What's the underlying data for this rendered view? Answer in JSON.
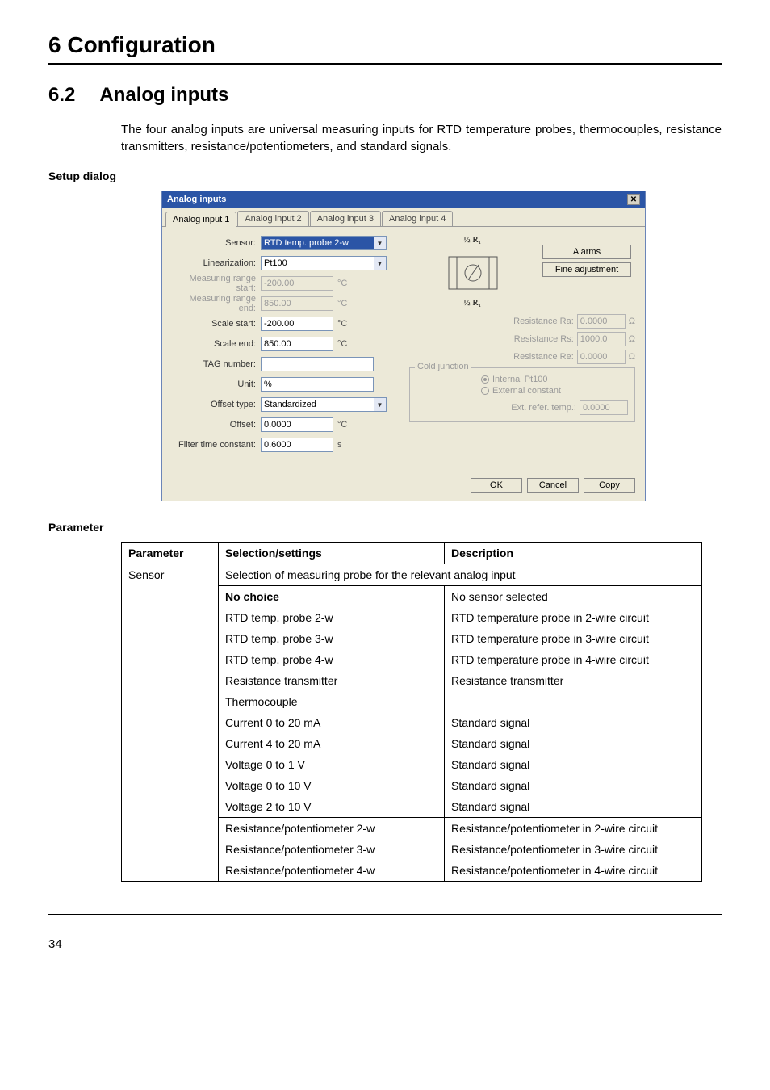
{
  "chapter_title": "6 Configuration",
  "section": {
    "num": "6.2",
    "name": "Analog inputs"
  },
  "intro": "The four analog inputs are universal measuring inputs for RTD temperature probes, thermocouples, resistance transmitters, resistance/potentiometers, and standard signals.",
  "subhead_setup": "Setup dialog",
  "subhead_param": "Parameter",
  "dialog": {
    "title": "Analog inputs",
    "tabs": [
      "Analog input 1",
      "Analog input 2",
      "Analog input 3",
      "Analog input 4"
    ],
    "active_tab": 0,
    "fields": {
      "sensor_label": "Sensor:",
      "sensor_value": "RTD temp. probe 2-w",
      "lin_label": "Linearization:",
      "lin_value": "Pt100",
      "mrstart_label": "Measuring range start:",
      "mrstart_value": "-200.00",
      "mrstart_unit": "°C",
      "mrend_label": "Measuring range end:",
      "mrend_value": "850.00",
      "mrend_unit": "°C",
      "sstart_label": "Scale start:",
      "sstart_value": "-200.00",
      "sstart_unit": "°C",
      "send_label": "Scale end:",
      "send_value": "850.00",
      "send_unit": "°C",
      "tag_label": "TAG number:",
      "tag_value": "",
      "unit_label": "Unit:",
      "unit_value": "%",
      "otype_label": "Offset type:",
      "otype_value": "Standardized",
      "offset_label": "Offset:",
      "offset_value": "0.0000",
      "offset_unit": "°C",
      "filter_label": "Filter time constant:",
      "filter_value": "0.6000",
      "filter_unit": "s"
    },
    "right": {
      "alarms": "Alarms",
      "fine": "Fine adjustment",
      "half_r1_top": "½ R₁",
      "half_r1_bot": "½ R₁",
      "res_ra_label": "Resistance Ra:",
      "res_ra_value": "0.0000",
      "ohm": "Ω",
      "res_rs_label": "Resistance Rs:",
      "res_rs_value": "1000.0",
      "res_re_label": "Resistance Re:",
      "res_re_value": "0.0000",
      "cj_legend": "Cold junction",
      "radio_int": "Internal Pt100",
      "radio_ext": "External constant",
      "ext_label": "Ext. refer. temp.:",
      "ext_value": "0.0000"
    },
    "buttons": {
      "ok": "OK",
      "cancel": "Cancel",
      "copy": "Copy"
    }
  },
  "table": {
    "headers": [
      "Parameter",
      "Selection/settings",
      "Description"
    ],
    "sensor_label": "Sensor",
    "sensor_span": "Selection of measuring probe for the relevant analog input",
    "rows": [
      {
        "sel": "No choice",
        "desc": "No sensor selected",
        "bold": true
      },
      {
        "sel": "RTD temp. probe 2-w",
        "desc": "RTD temperature probe in 2-wire circuit"
      },
      {
        "sel": "RTD temp. probe 3-w",
        "desc": "RTD temperature probe in 3-wire circuit"
      },
      {
        "sel": "RTD temp. probe 4-w",
        "desc": "RTD temperature probe in 4-wire circuit"
      },
      {
        "sel": "Resistance transmitter",
        "desc": "Resistance transmitter"
      },
      {
        "sel": "Thermocouple",
        "desc": ""
      },
      {
        "sel": "Current 0 to 20 mA",
        "desc": "Standard signal"
      },
      {
        "sel": "Current 4 to 20 mA",
        "desc": "Standard signal"
      },
      {
        "sel": "Voltage 0 to 1 V",
        "desc": "Standard signal"
      },
      {
        "sel": "Voltage 0 to 10 V",
        "desc": "Standard signal"
      },
      {
        "sel": "Voltage 2 to 10 V",
        "desc": "Standard signal"
      }
    ],
    "rows2": [
      {
        "sel": "Resistance/potentiometer 2-w",
        "desc": "Resistance/potentiometer in 2-wire circuit"
      },
      {
        "sel": "Resistance/potentiometer 3-w",
        "desc": "Resistance/potentiometer in 3-wire circuit"
      },
      {
        "sel": "Resistance/potentiometer 4-w",
        "desc": "Resistance/potentiometer in 4-wire circuit"
      }
    ]
  },
  "page_number": "34"
}
